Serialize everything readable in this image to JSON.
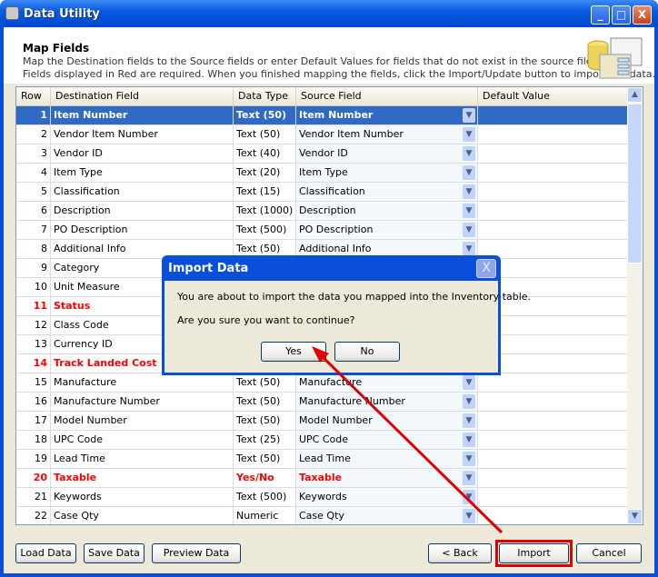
{
  "window": {
    "title": "Data Utility",
    "minimize": "_",
    "maximize": "□",
    "close": "X"
  },
  "header": {
    "title": "Map Fields",
    "line1": "Map the Destination fields to the Source fields or enter Default Values for fields that do not exist in the source file.",
    "line2": "Fields displayed in Red are required.  When you finished mapping the fields, click the Import/Update button to import the data."
  },
  "grid": {
    "columns": [
      "Row",
      "Destination Field",
      "Data Type",
      "Source Field",
      "Default Value"
    ],
    "rows": [
      {
        "row": "1",
        "dest": "Item Number",
        "type": "Text (50)",
        "source": "Item Number",
        "required": false,
        "selected": true
      },
      {
        "row": "2",
        "dest": "Vendor Item Number",
        "type": "Text (50)",
        "source": "Vendor Item Number"
      },
      {
        "row": "3",
        "dest": "Vendor ID",
        "type": "Text (40)",
        "source": "Vendor ID"
      },
      {
        "row": "4",
        "dest": "Item Type",
        "type": "Text (20)",
        "source": "Item Type"
      },
      {
        "row": "5",
        "dest": "Classification",
        "type": "Text (15)",
        "source": "Classification"
      },
      {
        "row": "6",
        "dest": "Description",
        "type": "Text (1000)",
        "source": "Description"
      },
      {
        "row": "7",
        "dest": "PO Description",
        "type": "Text (500)",
        "source": "PO Description"
      },
      {
        "row": "8",
        "dest": "Additional Info",
        "type": "Text (50)",
        "source": "Additional Info"
      },
      {
        "row": "9",
        "dest": "Category",
        "type": "",
        "source": ""
      },
      {
        "row": "10",
        "dest": "Unit Measure",
        "type": "",
        "source": ""
      },
      {
        "row": "11",
        "dest": "Status",
        "type": "",
        "source": "",
        "required": true
      },
      {
        "row": "12",
        "dest": "Class Code",
        "type": "",
        "source": ""
      },
      {
        "row": "13",
        "dest": "Currency ID",
        "type": "",
        "source": ""
      },
      {
        "row": "14",
        "dest": "Track Landed Cost",
        "type": "",
        "source": "",
        "required": true
      },
      {
        "row": "15",
        "dest": "Manufacture",
        "type": "Text (50)",
        "source": "Manufacture"
      },
      {
        "row": "16",
        "dest": "Manufacture Number",
        "type": "Text (50)",
        "source": "Manufacture Number"
      },
      {
        "row": "17",
        "dest": "Model Number",
        "type": "Text (50)",
        "source": "Model Number"
      },
      {
        "row": "18",
        "dest": "UPC Code",
        "type": "Text (25)",
        "source": "UPC Code"
      },
      {
        "row": "19",
        "dest": "Lead Time",
        "type": "Text (50)",
        "source": "Lead Time"
      },
      {
        "row": "20",
        "dest": "Taxable",
        "type": "Yes/No",
        "source": "Taxable",
        "required": true
      },
      {
        "row": "21",
        "dest": "Keywords",
        "type": "Text (500)",
        "source": "Keywords"
      },
      {
        "row": "22",
        "dest": "Case Qty",
        "type": "Numeric",
        "source": "Case Qty"
      }
    ]
  },
  "footer": {
    "load": "Load Data",
    "save": "Save Data",
    "preview": "Preview Data",
    "back": "< Back",
    "import": "Import",
    "cancel": "Cancel"
  },
  "dialog": {
    "title": "Import Data",
    "message": "You are about to import the data you mapped into the  Inventory table.",
    "question": "Are you sure you want to continue?",
    "yes": "Yes",
    "no": "No",
    "close": "X"
  },
  "colors": {
    "selection": "#316ac5",
    "required": "#ff0000",
    "annotation": "#e00000",
    "titlebar": "#0a4fd9"
  }
}
